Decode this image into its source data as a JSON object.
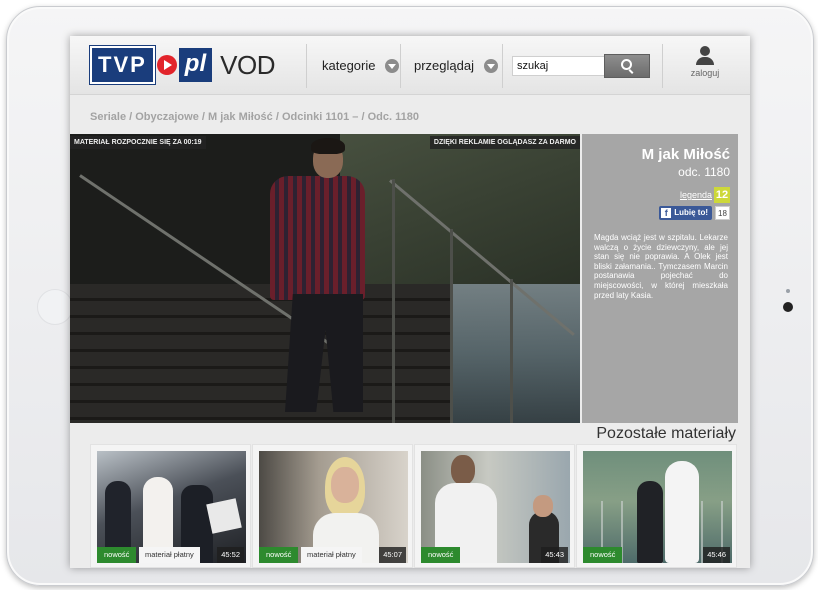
{
  "header": {
    "logo": {
      "tvp": "TVP",
      "pl": "pl",
      "vod": "VOD"
    },
    "nav": [
      {
        "label": "kategorie"
      },
      {
        "label": "przeglądaj"
      }
    ],
    "search": {
      "value": "szukaj"
    },
    "login_label": "zaloguj"
  },
  "breadcrumb": "Seriale / Obyczajowe / M jak Miłość / Odcinki 1101 – / Odc. 1180",
  "player": {
    "countdown": "MATERIAŁ ROZPOCZNIE SIĘ ZA 00:19",
    "ad_notice": "DZIĘKI REKLAMIE OGLĄDASZ ZA DARMO"
  },
  "info": {
    "title": "M jak Miłość",
    "episode": "odc. 1180",
    "legend_label": "legenda",
    "age_rating": "12",
    "like_label": "Lubię to!",
    "like_count": "18",
    "description": "Magda wciąż jest w szpitalu. Lekarze walczą o życie dziewczyny, ale jej stan się nie poprawia. A Olek jest bliski załamania.. Tymczasem Marcin postanawia pojechać do miejscowości, w której mieszkała przed laty Kasia."
  },
  "more": {
    "title": "Pozostałe materiały",
    "items": [
      {
        "new_label": "nowość",
        "paid_label": "materiał płatny",
        "duration": "45:52"
      },
      {
        "new_label": "nowość",
        "paid_label": "materiał płatny",
        "duration": "45:07"
      },
      {
        "new_label": "nowość",
        "paid_label": "",
        "duration": "45:43"
      },
      {
        "new_label": "nowość",
        "paid_label": "",
        "duration": "45:46"
      }
    ]
  },
  "colors": {
    "brand_blue": "#1a3d7c",
    "brand_red": "#e2242b",
    "badge_green": "#2d8a2e",
    "info_panel": "#a6a6a6"
  }
}
